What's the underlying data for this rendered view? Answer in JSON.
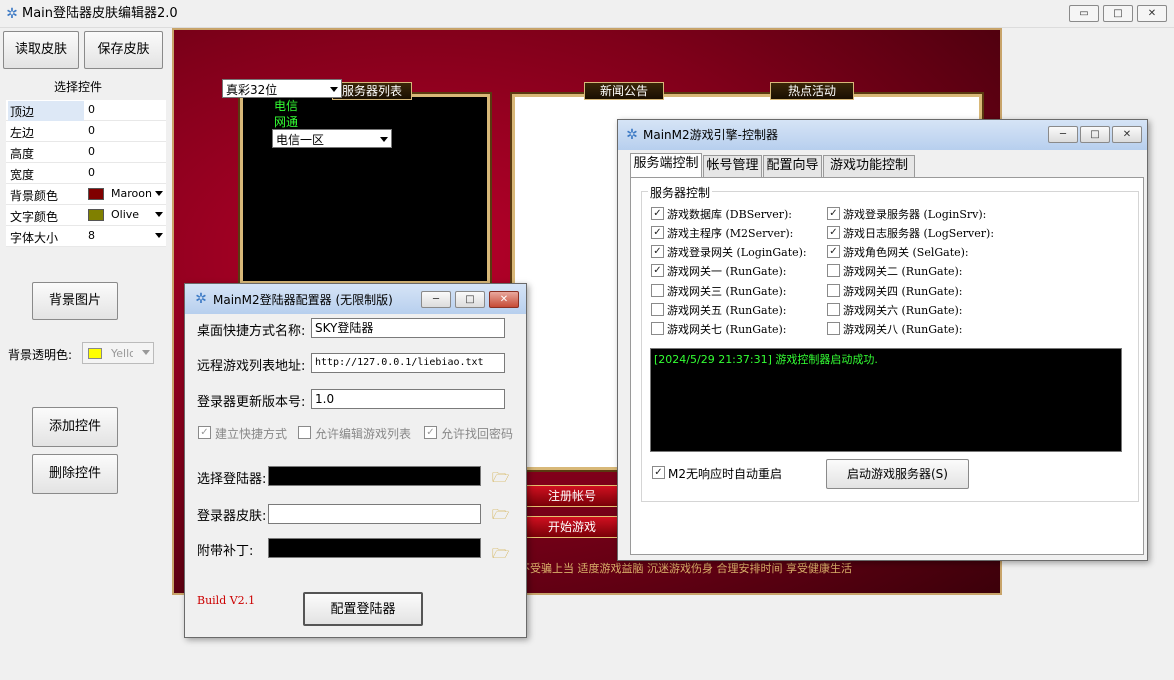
{
  "window": {
    "title": "Main登陆器皮肤编辑器2.0",
    "minimize": "▭",
    "maximize": "□",
    "close": "✕"
  },
  "toolbar": {
    "load_skin": "读取皮肤",
    "save_skin": "保存皮肤"
  },
  "props": {
    "header": "选择控件",
    "rows": [
      {
        "key": "顶边",
        "value": "0"
      },
      {
        "key": "左边",
        "value": "0"
      },
      {
        "key": "高度",
        "value": "0"
      },
      {
        "key": "宽度",
        "value": "0"
      },
      {
        "key": "背景颜色",
        "value": "Maroon",
        "swatch": "#800000"
      },
      {
        "key": "文字颜色",
        "value": "Olive",
        "swatch": "#808000"
      },
      {
        "key": "字体大小",
        "value": "8"
      }
    ]
  },
  "side": {
    "bg_image": "背景图片",
    "transparent_label": "背景透明色:",
    "transparent_value": "Yello",
    "transparent_swatch": "#ffff00",
    "add_control": "添加控件",
    "delete_control": "删除控件"
  },
  "skin": {
    "color_mode": "真彩32位",
    "server_list": "服务器列表",
    "news": "新闻公告",
    "hot": "热点活动",
    "tree": [
      "电信",
      "网通"
    ],
    "zone": "电信一区",
    "register": "注册帐号",
    "start": "开始游戏",
    "footer": "不受骗上当 适度游戏益脑 沉迷游戏伤身 合理安排时间 享受健康生活"
  },
  "config_dlg": {
    "title": "MainM2登陆器配置器 (无限制版)",
    "shortcut_label": "桌面快捷方式名称:",
    "shortcut_value": "SKY登陆器",
    "list_label": "远程游戏列表地址:",
    "list_value": "http://127.0.0.1/liebiao.txt",
    "version_label": "登录器更新版本号:",
    "version_value": "1.0",
    "opt1": "建立快捷方式",
    "opt2": "允许编辑游戏列表",
    "opt3": "允许找回密码",
    "select_label": "选择登陆器:",
    "skin_label": "登录器皮肤:",
    "patch_label": "附带补丁:",
    "build": "Build V2.1",
    "config_button": "配置登陆器"
  },
  "engine_dlg": {
    "title": "MainM2游戏引擎-控制器",
    "tabs": [
      "服务端控制",
      "帐号管理",
      "配置向导",
      "游戏功能控制"
    ],
    "group": "服务器控制",
    "left_items": [
      {
        "label": "游戏数据库 (DBServer):",
        "checked": true
      },
      {
        "label": "游戏主程序 (M2Server):",
        "checked": true
      },
      {
        "label": "游戏登录网关 (LoginGate):",
        "checked": true
      },
      {
        "label": "游戏网关一 (RunGate):",
        "checked": true
      },
      {
        "label": "游戏网关三 (RunGate):",
        "checked": false
      },
      {
        "label": "游戏网关五 (RunGate):",
        "checked": false
      },
      {
        "label": "游戏网关七 (RunGate):",
        "checked": false
      }
    ],
    "right_items": [
      {
        "label": "游戏登录服务器 (LoginSrv):",
        "checked": true
      },
      {
        "label": "游戏日志服务器 (LogServer):",
        "checked": true
      },
      {
        "label": "游戏角色网关 (SelGate):",
        "checked": true
      },
      {
        "label": "游戏网关二 (RunGate):",
        "checked": false
      },
      {
        "label": "游戏网关四 (RunGate):",
        "checked": false
      },
      {
        "label": "游戏网关六 (RunGate):",
        "checked": false
      },
      {
        "label": "游戏网关八 (RunGate):",
        "checked": false
      }
    ],
    "log": "[2024/5/29 21:37:31] 游戏控制器启动成功.",
    "auto_restart": "M2无响应时自动重启",
    "start_button": "启动游戏服务器(S)"
  },
  "colors": {
    "log_text": "#33ff33",
    "tree_text": "#33ff33",
    "build_text": "#cc0000"
  }
}
